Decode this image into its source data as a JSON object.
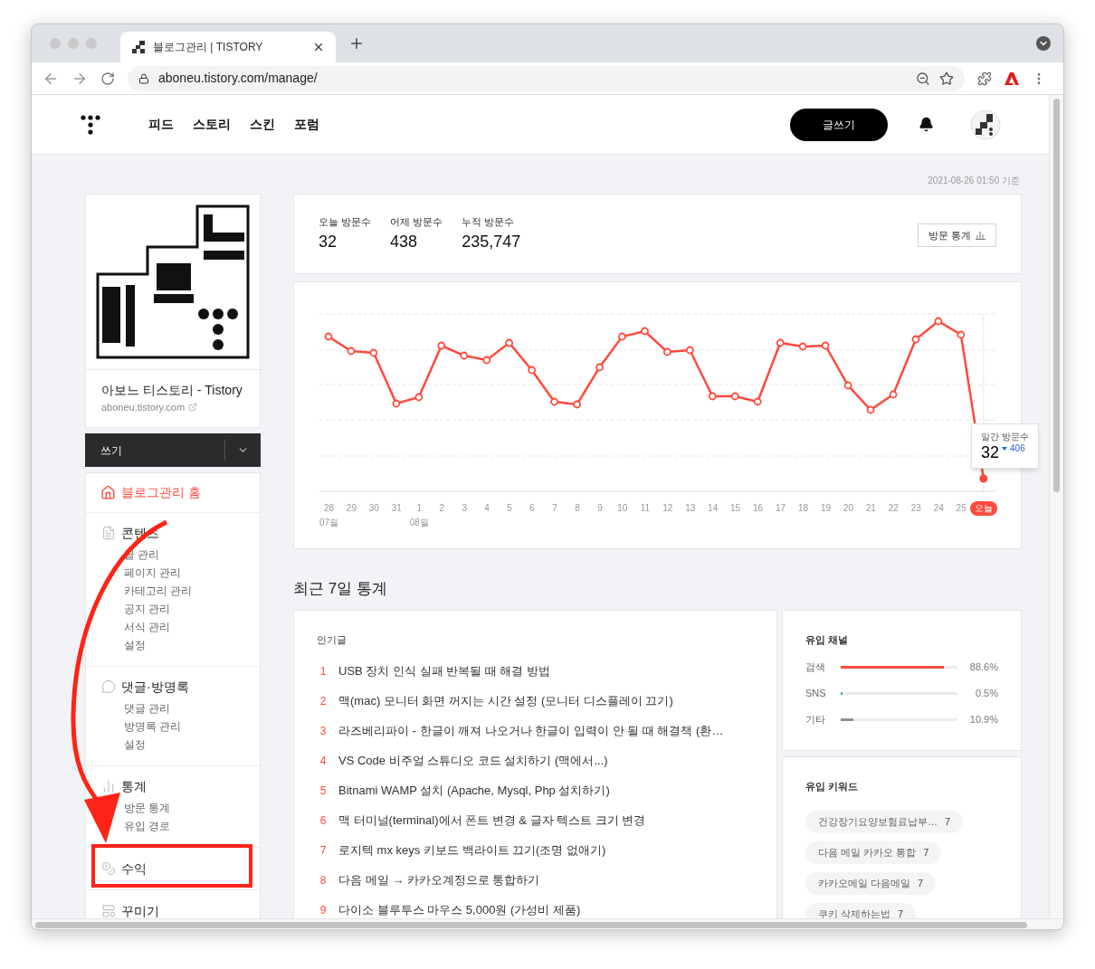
{
  "browser": {
    "tab": {
      "title": "블로그관리 | TISTORY",
      "selected": true
    },
    "address": "aboneu.tistory.com/manage/"
  },
  "header": {
    "nav": [
      "피드",
      "스토리",
      "스킨",
      "포럼"
    ],
    "write_button": "글쓰기"
  },
  "timestamp": "2021-08-26 01:50 기준",
  "blog": {
    "title": "아보느 티스토리 - Tistory",
    "url": "aboneu.tistory.com"
  },
  "write_menu": {
    "label": "쓰기"
  },
  "sidebar": {
    "home": {
      "label": "블로그관리 홈",
      "selected": true
    },
    "sections": [
      {
        "title": "콘텐츠",
        "kind": "document",
        "items": [
          {
            "label": "글 관리",
            "selected": false
          },
          {
            "label": "페이지 관리",
            "selected": false
          },
          {
            "label": "카테고리 관리",
            "selected": false
          },
          {
            "label": "공지 관리",
            "selected": false
          },
          {
            "label": "서식 관리",
            "selected": false
          },
          {
            "label": "설정",
            "selected": false
          }
        ]
      },
      {
        "title": "댓글·방명록",
        "kind": "comment",
        "items": [
          {
            "label": "댓글 관리",
            "selected": false
          },
          {
            "label": "방명록 관리",
            "selected": false
          },
          {
            "label": "설정",
            "selected": false
          }
        ]
      },
      {
        "title": "통계",
        "kind": "chart",
        "items": [
          {
            "label": "방문 통계",
            "selected": false
          },
          {
            "label": "유입 경로",
            "selected": false
          }
        ]
      },
      {
        "title": "수익",
        "kind": "coins"
      },
      {
        "title": "꾸미기",
        "kind": "layout"
      }
    ]
  },
  "stats": [
    {
      "label": "오늘 방문수",
      "value": "32"
    },
    {
      "label": "어제 방문수",
      "value": "438"
    },
    {
      "label": "누적 방문수",
      "value": "235,747"
    }
  ],
  "stats_button": "방문 통계",
  "chart": {
    "x_labels": [
      {
        "day": "28",
        "month": "07월",
        "kind": "day"
      },
      {
        "day": "29",
        "kind": "day"
      },
      {
        "day": "30",
        "kind": "day"
      },
      {
        "day": "31",
        "kind": "day"
      },
      {
        "day": "1",
        "month": "08월",
        "kind": "day"
      },
      {
        "day": "2",
        "kind": "day"
      },
      {
        "day": "3",
        "kind": "day"
      },
      {
        "day": "4",
        "kind": "day"
      },
      {
        "day": "5",
        "kind": "day"
      },
      {
        "day": "6",
        "kind": "day"
      },
      {
        "day": "7",
        "kind": "day"
      },
      {
        "day": "8",
        "kind": "day"
      },
      {
        "day": "9",
        "kind": "day"
      },
      {
        "day": "10",
        "kind": "day"
      },
      {
        "day": "11",
        "kind": "day"
      },
      {
        "day": "12",
        "kind": "day"
      },
      {
        "day": "13",
        "kind": "day"
      },
      {
        "day": "14",
        "kind": "day"
      },
      {
        "day": "15",
        "kind": "day"
      },
      {
        "day": "16",
        "kind": "day"
      },
      {
        "day": "17",
        "kind": "day"
      },
      {
        "day": "18",
        "kind": "day"
      },
      {
        "day": "19",
        "kind": "day"
      },
      {
        "day": "20",
        "kind": "day"
      },
      {
        "day": "21",
        "kind": "day"
      },
      {
        "day": "22",
        "kind": "day"
      },
      {
        "day": "23",
        "kind": "day"
      },
      {
        "day": "24",
        "kind": "day"
      },
      {
        "day": "25",
        "kind": "day"
      },
      {
        "day": "오늘",
        "kind": "today"
      }
    ],
    "tooltip": {
      "title": "일간 방문수",
      "value": "32",
      "change": "406",
      "kind": "down"
    }
  },
  "recent_title": "최근 7일 통계",
  "popular": {
    "title": "인기글",
    "posts": [
      {
        "rank": "1",
        "title": "USB 장치 인식 실패 반복될 때 해결 방법"
      },
      {
        "rank": "2",
        "title": "맥(mac) 모니터 화면 꺼지는 시간 설정 (모니터 디스플레이 끄기)"
      },
      {
        "rank": "3",
        "title": "라즈베리파이 - 한글이 깨져 나오거나 한글이 입력이 안 될 때 해결책 (환…"
      },
      {
        "rank": "4",
        "title": "VS Code 비주얼 스튜디오 코드 설치하기 (맥에서...)"
      },
      {
        "rank": "5",
        "title": "Bitnami WAMP 설치 (Apache, Mysql, Php 설치하기)"
      },
      {
        "rank": "6",
        "title": "맥 터미널(terminal)에서 폰트 변경 & 글자 텍스트 크기 변경"
      },
      {
        "rank": "7",
        "title": "로지텍 mx keys 키보드 백라이트 끄기(조명 없애기)"
      },
      {
        "rank": "8",
        "title": "다음 메일 → 카카오계정으로 통합하기"
      },
      {
        "rank": "9",
        "title": "다이소 블루투스 마우스 5,000원 (가성비 제품)"
      }
    ]
  },
  "channels": {
    "title": "유입 채널",
    "items": [
      {
        "name": "검색",
        "level": 0.886,
        "reading": "88.6%",
        "color": "#ff4a3d"
      },
      {
        "name": "SNS",
        "level": 0.005,
        "reading": "0.5%",
        "color": "#1fc8a0"
      },
      {
        "name": "기타",
        "level": 0.109,
        "reading": "10.9%",
        "color": "#8a929e"
      }
    ]
  },
  "keywords": {
    "title": "유입 키워드",
    "items": [
      {
        "keyword": "건강장기요양보험료납부…",
        "count": "7"
      },
      {
        "keyword": "다음 메일 카카오 통합",
        "count": "7"
      },
      {
        "keyword": "카카오메일 다음메일",
        "count": "7"
      },
      {
        "keyword": "쿠키 삭제하는법",
        "count": "7"
      }
    ]
  }
}
